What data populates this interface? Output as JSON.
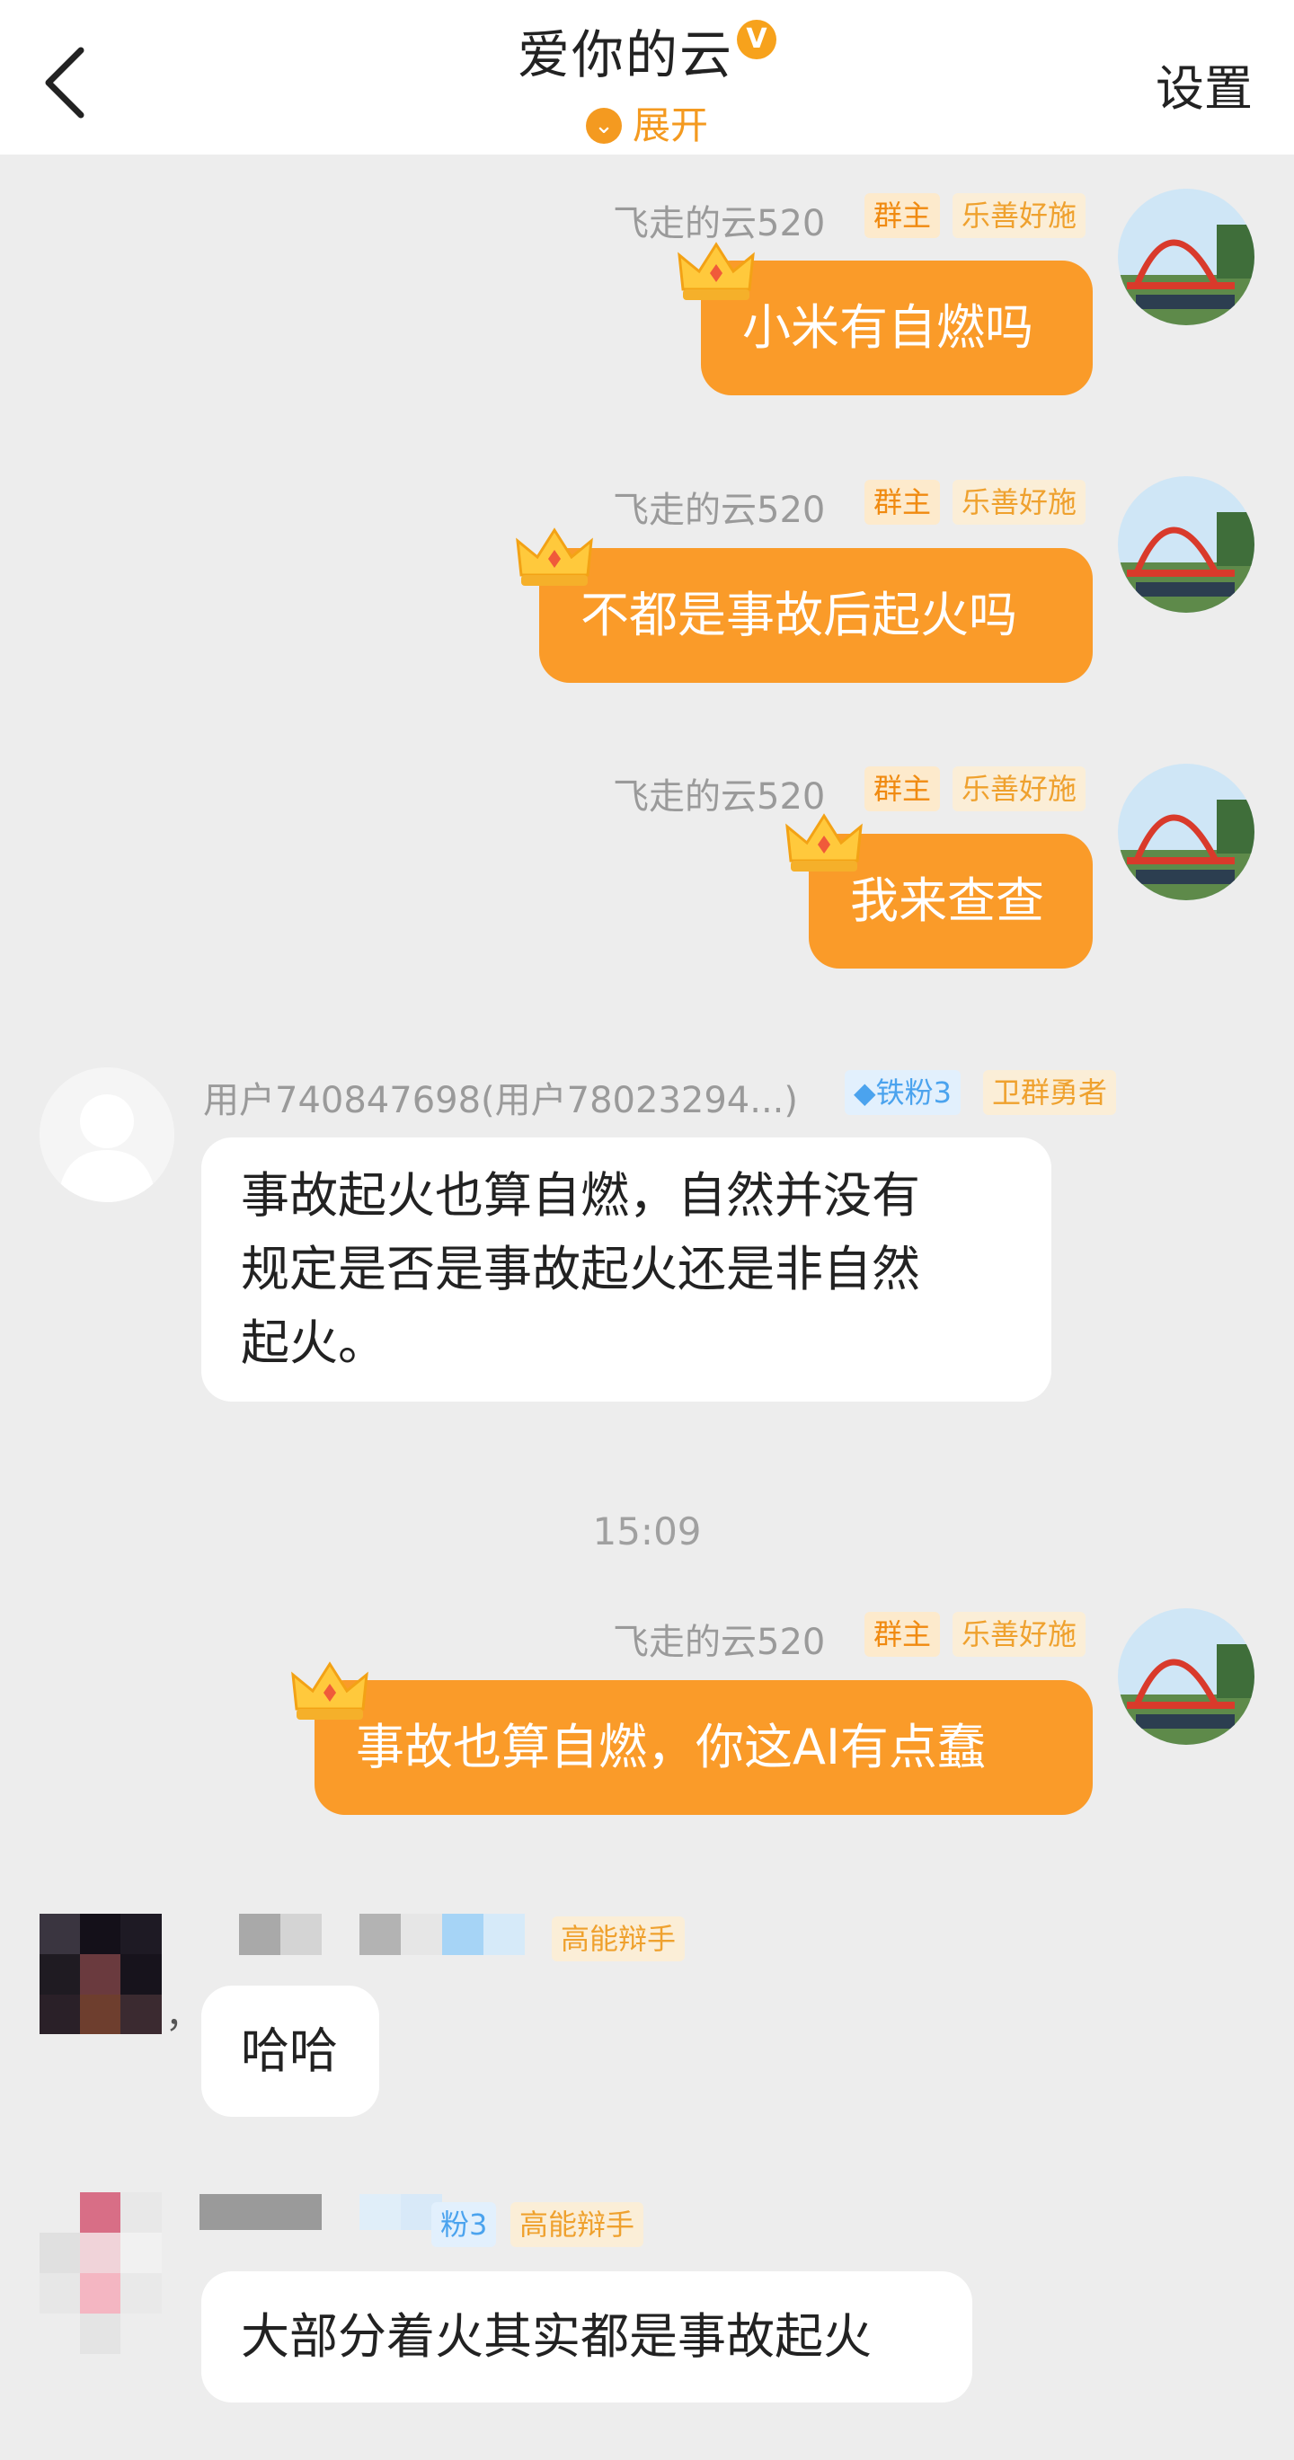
{
  "header": {
    "title": "爱你的云",
    "verified_icon": "v-badge-icon",
    "verified_letter": "V",
    "expand_label": "展开",
    "expand_icon": "chevron-down-circle-icon",
    "settings_label": "设置",
    "back_icon": "chevron-left-icon"
  },
  "colors": {
    "accent": "#fa9b29",
    "background": "#ededed",
    "incoming_bubble": "#ffffff"
  },
  "messages": [
    {
      "direction": "out",
      "sender": "飞走的云520",
      "tags": [
        "群主",
        "乐善好施"
      ],
      "text": "小米有自燃吗"
    },
    {
      "direction": "out",
      "sender": "飞走的云520",
      "tags": [
        "群主",
        "乐善好施"
      ],
      "text": "不都是事故后起火吗"
    },
    {
      "direction": "out",
      "sender": "飞走的云520",
      "tags": [
        "群主",
        "乐善好施"
      ],
      "text": "我来查查"
    },
    {
      "direction": "in",
      "sender": "用户740847698(用户78023294...)",
      "tags": [
        "铁粉3",
        "卫群勇者"
      ],
      "text_lines": [
        "事故起火也算自燃，自然并没有",
        "规定是否是事故起火还是非自然",
        "起火。"
      ]
    },
    {
      "direction": "out",
      "sender": "飞走的云520",
      "tags": [
        "群主",
        "乐善好施"
      ],
      "text": "事故也算自燃，你这AI有点蠢"
    },
    {
      "direction": "in",
      "sender": "",
      "tags": [
        "高能辩手"
      ],
      "text": "哈哈"
    },
    {
      "direction": "in",
      "sender": "",
      "tags": [
        "粉3",
        "高能辩手"
      ],
      "text": "大部分着火其实都是事故起火"
    }
  ],
  "timestamp": "15:09",
  "extra_mark": "，"
}
